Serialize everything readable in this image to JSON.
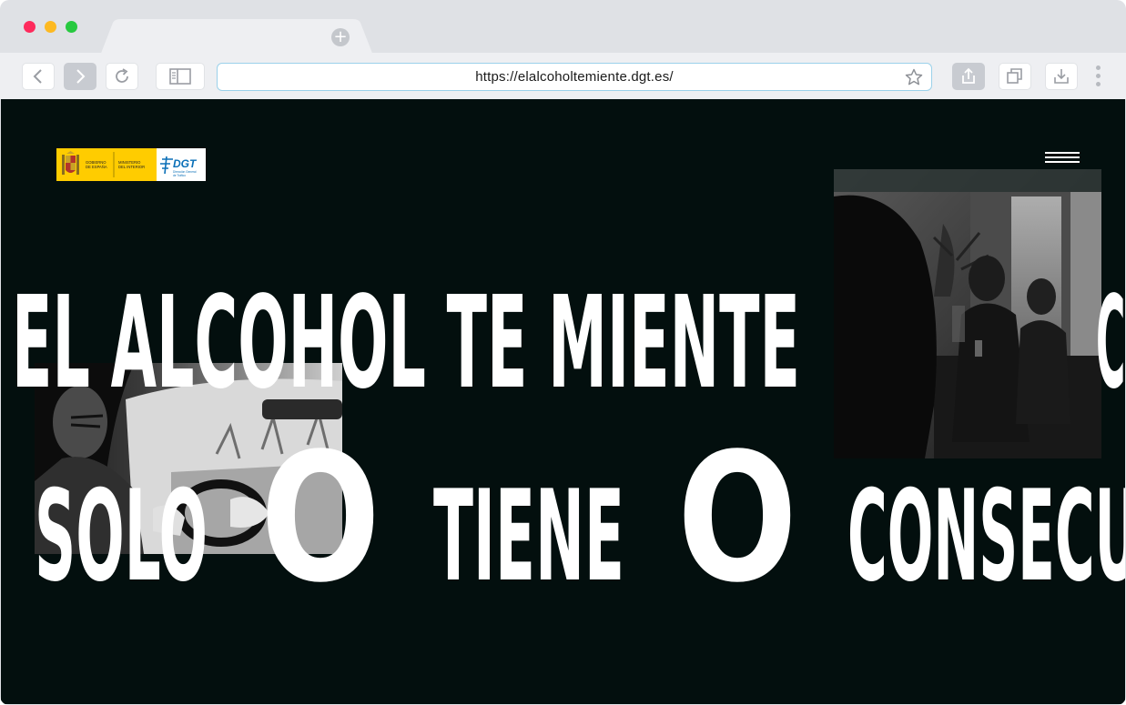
{
  "browser": {
    "url": "https://elalcoholtemiente.dgt.es/",
    "new_tab_symbol": "+",
    "buttons": [
      "back",
      "forward",
      "reload",
      "sidebar",
      "share",
      "tabs",
      "download",
      "menu"
    ]
  },
  "page": {
    "logo": {
      "gobierno_line1": "GOBIERNO",
      "gobierno_line2": "DE ESPAÑA",
      "ministerio_line1": "MINISTERIO",
      "ministerio_line2": "DEL INTERIOR",
      "dgt": "DGT",
      "dgt_sub1": "Dirección General",
      "dgt_sub2": "de Tráfico"
    },
    "headline": {
      "line1": "EL ALCOHOL TE MIENTE",
      "line1_cut": "CO",
      "line2_w1": "SOLO",
      "line2_w2": "TIENE",
      "line2_w3": "CONSECU",
      "big_o": "O"
    }
  },
  "colors": {
    "page_bg": "#030f0e",
    "text": "#ffffff",
    "logo_yellow": "#ffcc00",
    "dgt_blue": "#0a6fb7"
  }
}
